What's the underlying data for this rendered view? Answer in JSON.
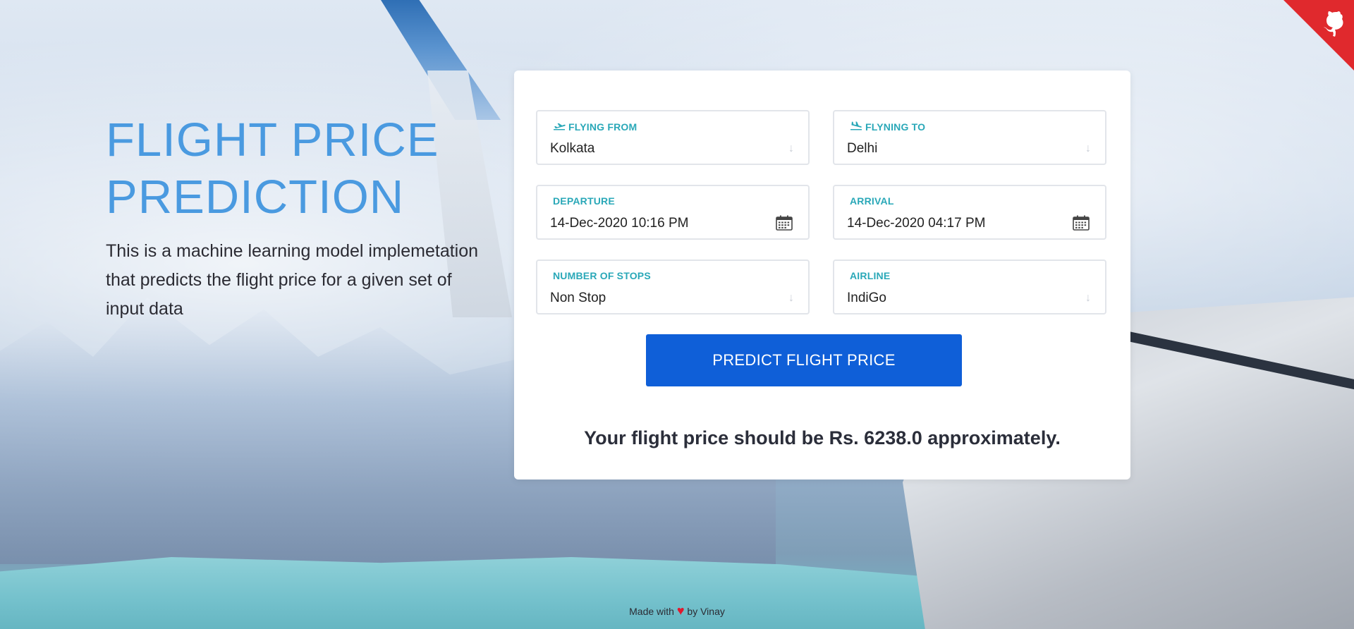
{
  "hero": {
    "title_line1": "FLIGHT PRICE",
    "title_line2": "PREDICTION",
    "description": "This is a machine learning model implemetation that predicts the flight price for a given set of input data"
  },
  "form": {
    "from": {
      "label": "FLYING FROM",
      "value": "Kolkata",
      "icon": "plane-takeoff-icon"
    },
    "to": {
      "label": "FLYNING TO",
      "value": "Delhi",
      "icon": "plane-landing-icon"
    },
    "departure": {
      "label": "DEPARTURE",
      "value": "14-Dec-2020 10:16 PM",
      "icon": "calendar-icon"
    },
    "arrival": {
      "label": "ARRIVAL",
      "value": "14-Dec-2020 04:17 PM",
      "icon": "calendar-icon"
    },
    "stops": {
      "label": "NUMBER OF STOPS",
      "value": "Non Stop"
    },
    "airline": {
      "label": "AIRLINE",
      "value": "IndiGo"
    },
    "submit_label": "PREDICT FLIGHT PRICE"
  },
  "result_text": "Your flight price should be Rs. 6238.0 approximately.",
  "footer": {
    "made_with": "Made with",
    "heart": "♥",
    "by": "by Vinay"
  },
  "corner": {
    "icon": "github-octocat-icon"
  },
  "colors": {
    "accent": "#4a9ae0",
    "label": "#2aa8b8",
    "button": "#0f5fd8",
    "corner": "#e0292d"
  }
}
